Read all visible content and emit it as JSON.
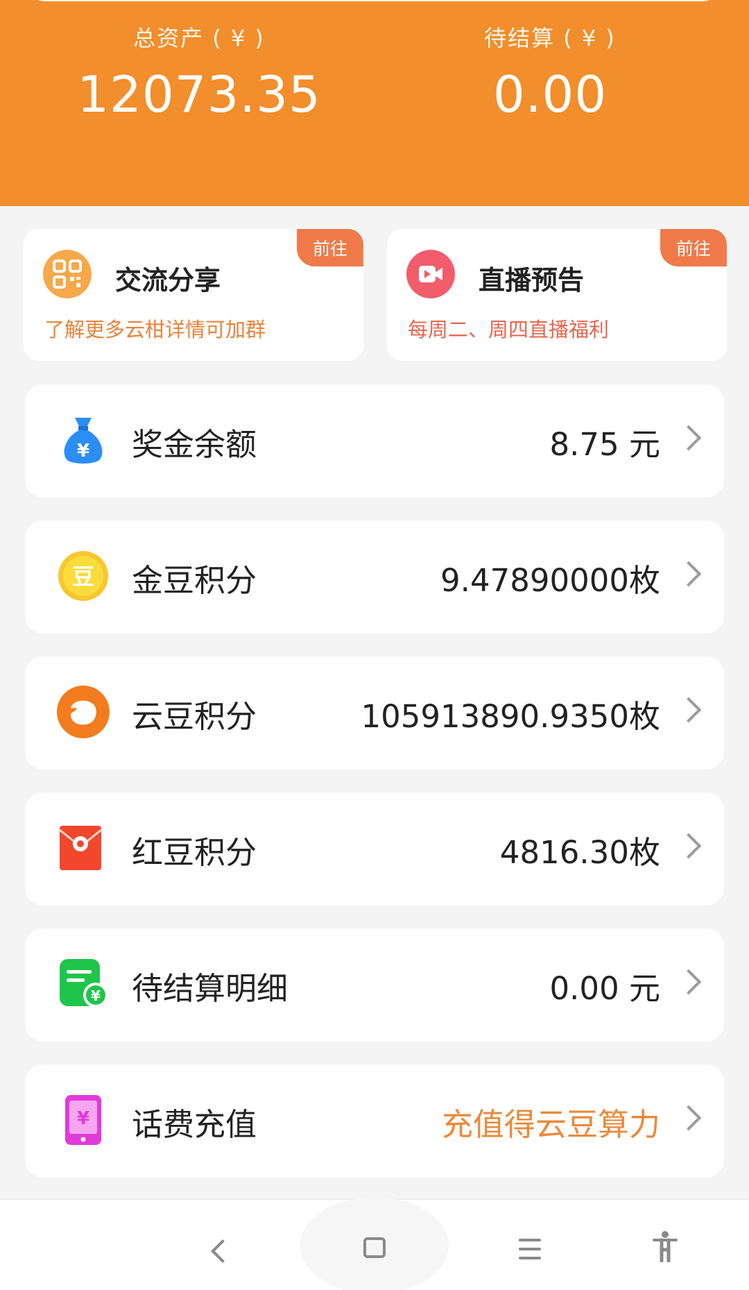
{
  "header": {
    "total_assets_label": "总资产 ( ¥ )",
    "total_assets_value": "12073.35",
    "pending_label": "待结算 ( ¥ )",
    "pending_value": "0.00",
    "bg_color": "#f28e2b"
  },
  "promos": [
    {
      "title": "交流分享",
      "subtitle": "了解更多云柑详情可加群",
      "badge": "前往",
      "icon": "qr-code-icon"
    },
    {
      "title": "直播预告",
      "subtitle": "每周二、周四直播福利",
      "badge": "前往",
      "icon": "video-camera-icon"
    }
  ],
  "rows": [
    {
      "label": "奖金余额",
      "value": "8.75 元",
      "icon": "money-bag-icon"
    },
    {
      "label": "金豆积分",
      "value": "9.47890000枚",
      "icon": "gold-bean-coin-icon"
    },
    {
      "label": "云豆积分",
      "value": "105913890.9350枚",
      "icon": "cloud-bean-icon"
    },
    {
      "label": "红豆积分",
      "value": "4816.30枚",
      "icon": "red-envelope-icon"
    },
    {
      "label": "待结算明细",
      "value": "0.00 元",
      "icon": "bill-yuan-icon"
    },
    {
      "label": "话费充值",
      "value": "充值得云豆算力",
      "icon": "phone-yuan-icon"
    }
  ],
  "colors": {
    "accent": "#f28e2b",
    "badge": "#f07a4a",
    "promo_sub_left": "#e8833a",
    "promo_sub_right": "#e4674f",
    "recharge_value": "#ea8a3a"
  },
  "navbar": {
    "buttons": [
      "back-icon",
      "home-icon",
      "menu-icon",
      "accessibility-icon"
    ]
  }
}
